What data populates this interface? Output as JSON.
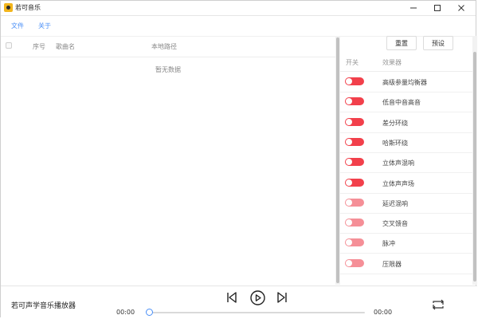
{
  "window": {
    "title": "若可音乐"
  },
  "menu": {
    "items": [
      "文件",
      "关于"
    ]
  },
  "table": {
    "columns": [
      "序号",
      "歌曲名",
      "本地路径"
    ],
    "empty_text": "暂无数据"
  },
  "panel": {
    "buttons": {
      "reset": "重置",
      "preset": "预设"
    },
    "headers": {
      "switch": "开关",
      "effect": "效果器"
    },
    "effects": [
      {
        "name": "高级参量均衡器",
        "state": "on"
      },
      {
        "name": "低音中音高音",
        "state": "on"
      },
      {
        "name": "差分环绕",
        "state": "on"
      },
      {
        "name": "哈斯环绕",
        "state": "on"
      },
      {
        "name": "立体声混响",
        "state": "on"
      },
      {
        "name": "立体声声场",
        "state": "on"
      },
      {
        "name": "延迟混响",
        "state": "light"
      },
      {
        "name": "交叉馈音",
        "state": "light"
      },
      {
        "name": "脉冲",
        "state": "light"
      },
      {
        "name": "压限器",
        "state": "light"
      }
    ]
  },
  "player": {
    "title": "若可声学音乐播放器",
    "current_time": "00:00",
    "total_time": "00:00",
    "progress": 0
  },
  "colors": {
    "accent": "#4a8ff7",
    "toggle_on": "#f2404b",
    "toggle_light": "#f58f97"
  },
  "icons": [
    "app-logo-icon",
    "minimize-icon",
    "maximize-icon",
    "close-icon",
    "skip-previous-icon",
    "play-icon",
    "skip-next-icon",
    "repeat-icon"
  ]
}
